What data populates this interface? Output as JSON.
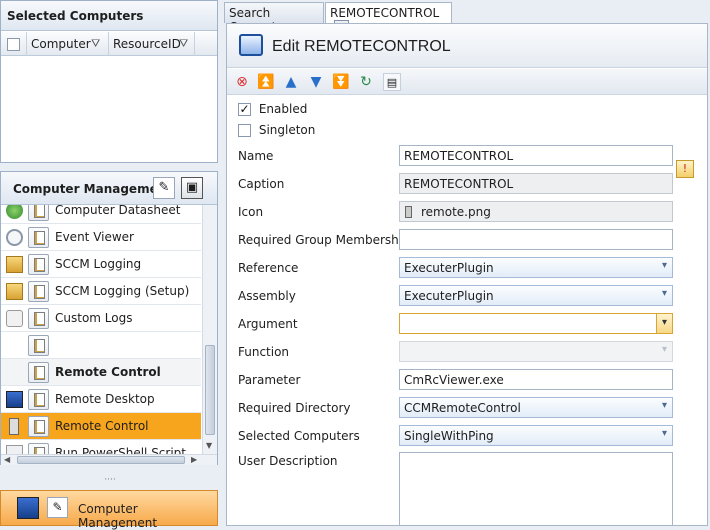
{
  "selected_computers": {
    "title": "Selected Computers",
    "columns": [
      "Computer",
      "ResourceID"
    ]
  },
  "computer_management": {
    "title": "Computer Management",
    "items": [
      {
        "label": "Computer Datasheet",
        "icon": "globe-icon"
      },
      {
        "label": "Event Viewer",
        "icon": "clock-icon"
      },
      {
        "label": "SCCM Logging",
        "icon": "folder-icon"
      },
      {
        "label": "SCCM Logging (Setup)",
        "icon": "folder-icon"
      },
      {
        "label": "Custom Logs",
        "icon": "scroll-icon"
      },
      {
        "label": "",
        "icon": ""
      },
      {
        "label": "Remote Control",
        "icon": "",
        "group": true
      },
      {
        "label": "Remote Desktop",
        "icon": "monitor-icon"
      },
      {
        "label": "Remote Control",
        "icon": "remote-icon",
        "selected": true
      },
      {
        "label": "Run PowerShell Script",
        "icon": "script-run-icon"
      }
    ],
    "bottom_nav_label": "Computer Management"
  },
  "tabs": [
    {
      "label": "Search Computer"
    },
    {
      "label": "REMOTECONTROL",
      "active": true
    }
  ],
  "editor": {
    "title": "Edit REMOTECONTROL",
    "enabled_label": "Enabled",
    "enabled": true,
    "singleton_label": "Singleton",
    "singleton": false,
    "fields": {
      "name": {
        "label": "Name",
        "value": "REMOTECONTROL"
      },
      "caption": {
        "label": "Caption",
        "value": "REMOTECONTROL"
      },
      "icon": {
        "label": "Icon",
        "value": "remote.png"
      },
      "required_group": {
        "label": "Required Group Membership",
        "value": ""
      },
      "reference": {
        "label": "Reference",
        "value": "ExecuterPlugin"
      },
      "assembly": {
        "label": "Assembly",
        "value": "ExecuterPlugin"
      },
      "argument": {
        "label": "Argument",
        "value": ""
      },
      "function": {
        "label": "Function",
        "value": ""
      },
      "parameter": {
        "label": "Parameter",
        "value": "CmRcViewer.exe"
      },
      "required_directory": {
        "label": "Required Directory",
        "value": "CCMRemoteControl"
      },
      "selected_computers": {
        "label": "Selected Computers",
        "value": "SingleWithPing"
      },
      "user_description": {
        "label": "User Description",
        "value": ""
      }
    }
  },
  "colors": {
    "selected_row": "#f7a51c",
    "accent": "#2a6fc9"
  }
}
